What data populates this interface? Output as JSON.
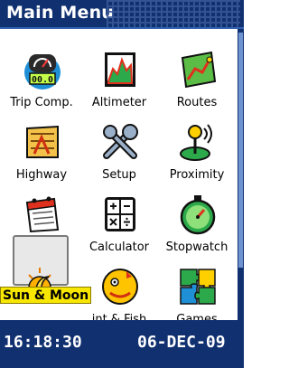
{
  "header": {
    "title": "Main Menu"
  },
  "menu": {
    "items": [
      {
        "label": "Trip Comp.",
        "icon": "trip-computer-icon"
      },
      {
        "label": "Altimeter",
        "icon": "altimeter-icon"
      },
      {
        "label": "Routes",
        "icon": "routes-icon"
      },
      {
        "label": "Highway",
        "icon": "highway-icon"
      },
      {
        "label": "Setup",
        "icon": "setup-icon"
      },
      {
        "label": "Proximity",
        "icon": "proximity-icon"
      },
      {
        "label": "Calendar",
        "icon": "calendar-icon"
      },
      {
        "label": "Calculator",
        "icon": "calculator-icon"
      },
      {
        "label": "Stopwatch",
        "icon": "stopwatch-icon"
      },
      {
        "label": "Sun & Moon",
        "icon": "sun-moon-icon"
      },
      {
        "label": "Hunt & Fish",
        "visible_label": "int & Fish",
        "icon": "hunt-fish-icon"
      },
      {
        "label": "Games",
        "icon": "games-icon"
      }
    ],
    "selected_label": "Sun & Moon",
    "trip_odometer_text": "00.0"
  },
  "status": {
    "time": "16:18:30",
    "date": "06-DEC-09"
  },
  "colors": {
    "bar_background": "#103070",
    "highlight": "#f7e600",
    "text_on_bar": "#ffffff"
  }
}
